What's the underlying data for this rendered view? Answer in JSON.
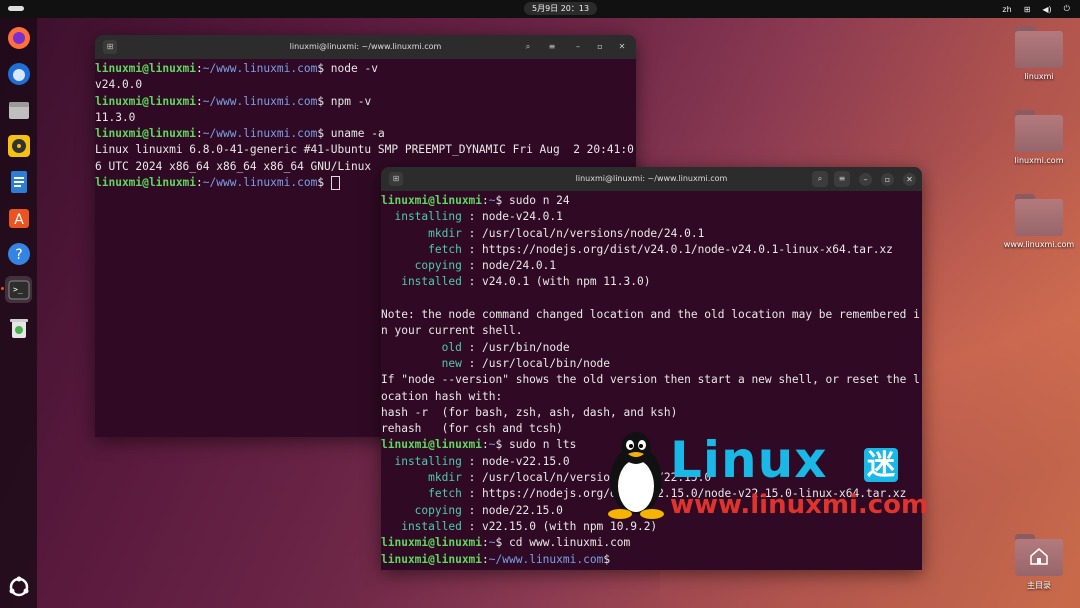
{
  "topbar": {
    "clock": "5月9日  20：13",
    "lang": "zh"
  },
  "desktop": {
    "icons": [
      {
        "label": "linuxmi"
      },
      {
        "label": "linuxmi.com"
      },
      {
        "label": "www.linuxmi.com"
      },
      {
        "label": "主目录"
      }
    ]
  },
  "dock": {
    "items": [
      "Firefox",
      "Thunderbird",
      "Files",
      "Rhythmbox",
      "Writer",
      "App Center",
      "Help",
      "Terminal",
      "Trash"
    ]
  },
  "term1": {
    "title": "linuxmi@linuxmi: ~/www.linuxmi.com",
    "user": "linuxmi@linuxmi",
    "path": "~/www.linuxmi.com",
    "lines": [
      {
        "type": "prompt",
        "cmd": "node -v"
      },
      {
        "type": "out",
        "text": "v24.0.0"
      },
      {
        "type": "prompt",
        "cmd": "npm -v"
      },
      {
        "type": "out",
        "text": "11.3.0"
      },
      {
        "type": "prompt",
        "cmd": "uname -a"
      },
      {
        "type": "out",
        "text": "Linux linuxmi 6.8.0-41-generic #41-Ubuntu SMP PREEMPT_DYNAMIC Fri Aug  2 20:41:0"
      },
      {
        "type": "out",
        "text": "6 UTC 2024 x86_64 x86_64 x86_64 GNU/Linux"
      },
      {
        "type": "prompt",
        "cmd": "",
        "cursor": true
      }
    ]
  },
  "term2": {
    "title": "linuxmi@linuxmi: ~/www.linuxmi.com",
    "user": "linuxmi@linuxmi",
    "path": "~/www.linuxmi.com",
    "lines": [
      {
        "type": "prompt",
        "cmd": "sudo n 24",
        "short": true
      },
      {
        "type": "kv",
        "key": "  installing",
        "val": "node-v24.0.1"
      },
      {
        "type": "kv",
        "key": "       mkdir",
        "val": "/usr/local/n/versions/node/24.0.1"
      },
      {
        "type": "kv",
        "key": "       fetch",
        "val": "https://nodejs.org/dist/v24.0.1/node-v24.0.1-linux-x64.tar.xz"
      },
      {
        "type": "kv",
        "key": "     copying",
        "val": "node/24.0.1"
      },
      {
        "type": "kv",
        "key": "   installed",
        "val": "v24.0.1 (with npm 11.3.0)"
      },
      {
        "type": "out",
        "text": ""
      },
      {
        "type": "out",
        "text": "Note: the node command changed location and the old location may be remembered i"
      },
      {
        "type": "out",
        "text": "n your current shell."
      },
      {
        "type": "kv",
        "key": "         old",
        "val": "/usr/bin/node"
      },
      {
        "type": "kv",
        "key": "         new",
        "val": "/usr/local/bin/node"
      },
      {
        "type": "out",
        "text": "If \"node --version\" shows the old version then start a new shell, or reset the l"
      },
      {
        "type": "out",
        "text": "ocation hash with:"
      },
      {
        "type": "out",
        "text": "hash -r  (for bash, zsh, ash, dash, and ksh)"
      },
      {
        "type": "out",
        "text": "rehash   (for csh and tcsh)"
      },
      {
        "type": "prompt",
        "cmd": "sudo n lts",
        "short": true
      },
      {
        "type": "kv",
        "key": "  installing",
        "val": "node-v22.15.0"
      },
      {
        "type": "kv",
        "key": "       mkdir",
        "val": "/usr/local/n/versions/node/22.15.0"
      },
      {
        "type": "kv",
        "key": "       fetch",
        "val": "https://nodejs.org/dist/v22.15.0/node-v22.15.0-linux-x64.tar.xz"
      },
      {
        "type": "kv",
        "key": "     copying",
        "val": "node/22.15.0"
      },
      {
        "type": "kv",
        "key": "   installed",
        "val": "v22.15.0 (with npm 10.9.2)"
      },
      {
        "type": "prompt",
        "cmd": "cd www.linuxmi.com",
        "short": true
      },
      {
        "type": "prompt",
        "cmd": ""
      }
    ]
  },
  "watermark": {
    "title": "Linux",
    "mi": "迷",
    "url": "www.linuxmi.com"
  }
}
